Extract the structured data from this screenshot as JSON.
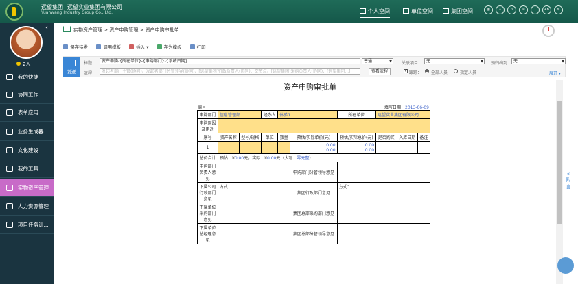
{
  "header": {
    "brand_cn": "远望集团",
    "company_cn": "远望实业集团有限公司",
    "company_en": "Yuanwang Industry Group Co., Ltd.",
    "nav": [
      {
        "label": "个人空间",
        "icon": "home-icon",
        "active": true
      },
      {
        "label": "单位空间",
        "icon": "building-icon",
        "active": false
      },
      {
        "label": "集团空间",
        "icon": "group-building-icon",
        "active": false
      }
    ],
    "right_icons": [
      "grid-icon",
      "search-icon",
      "refresh-icon",
      "chat-icon",
      "info-icon",
      "AB",
      "settings-icon"
    ],
    "ab_label": "AB"
  },
  "sidebar": {
    "online_count": "2人",
    "items": [
      {
        "label": "我的快捷",
        "icon": "plus-circle-icon",
        "active": false
      },
      {
        "label": "协同工作",
        "icon": "collaboration-icon",
        "active": false
      },
      {
        "label": "表单应用",
        "icon": "form-icon",
        "active": false
      },
      {
        "label": "业务生成器",
        "icon": "builder-icon",
        "active": false
      },
      {
        "label": "文化建设",
        "icon": "culture-icon",
        "active": false
      },
      {
        "label": "我的工具",
        "icon": "toolbox-icon",
        "active": false
      },
      {
        "label": "实物资产管理",
        "icon": "asset-icon",
        "active": true
      },
      {
        "label": "人力资源管理",
        "icon": "hr-icon",
        "active": false
      },
      {
        "label": "项目任务计...",
        "icon": "project-icon",
        "active": false
      }
    ]
  },
  "breadcrumb": "实物资产管理 > 资产申购管理 > 资产申购审批单",
  "toolbar": {
    "save_draft": "保存待发",
    "template": "调用模板",
    "insert": "插入",
    "save_as_template": "存为模板",
    "print": "打印"
  },
  "form_head": {
    "send_label": "发送",
    "title_label": "标题：",
    "title_value": "资产申购-{所在单位}-{申购部门}-{系统日期}",
    "priority_value": "普通",
    "related_label": "关联项目：",
    "related_value": "无",
    "archive_label": "预归档到：",
    "archive_value": "无",
    "flow_label": "流程：",
    "flow_placeholder": "发起者部门主管(协同)、发起者部门分管领导(协同)、[远望集团]行政负责人(协同)、交节点、[远望集团]采购负责人(协同)、[远望集团...]",
    "view_flow": "查看流程",
    "trace_label": "跟踪：",
    "trace_all": "全部人员",
    "trace_specified": "指定人员",
    "expand_label": "展开"
  },
  "document": {
    "title": "资产申购审批单",
    "number_label": "编号：",
    "date_label": "填写日期：",
    "date_value": "2013-06-09",
    "dept_label": "申购部门",
    "dept_value": "信息管理部",
    "handler_label": "经办人",
    "handler_value": "体验1",
    "unit_label": "所在单位",
    "unit_value": "远望实业集团有限公司",
    "reason_label": "申购原因及用途",
    "col_no": "序号",
    "col_name": "资产名称",
    "col_model": "型号/规格",
    "col_unit": "单位",
    "col_qty": "数量",
    "col_price": "预估/实际单价(元)",
    "col_total": "预估/实际总价(元)",
    "col_ordered": "是否购买",
    "col_indate": "入库日期",
    "col_note": "备注",
    "row_no": "1",
    "price1": "0.00",
    "price2": "0.00",
    "total1": "0.00",
    "total2": "0.00",
    "sum_label": "总价合计",
    "sum_text1": "预估：¥",
    "sum_est": "0.00",
    "sum_text2": "元，实际：¥",
    "sum_act": "0.00",
    "sum_text3": "元（大写：",
    "sum_upper": "零元整",
    "sum_text4": "）",
    "opinion_dept_head": "申购部门负责人意见",
    "opinion_dept_leader": "申购部门分管领导意见",
    "opinion_sub_admin": "下属公司行政部门意见",
    "opinion_group_admin": "集团行政部门意见",
    "method_label": "方式：",
    "opinion_sub_purchase": "下属单位采购部门意见",
    "opinion_group_purchase": "集团总部采购部门意见",
    "opinion_sub_manager": "下属单位总经理意见",
    "opinion_group_leader": "集团总部分管领导意见"
  },
  "side_panel": {
    "attach_label": "附言"
  }
}
